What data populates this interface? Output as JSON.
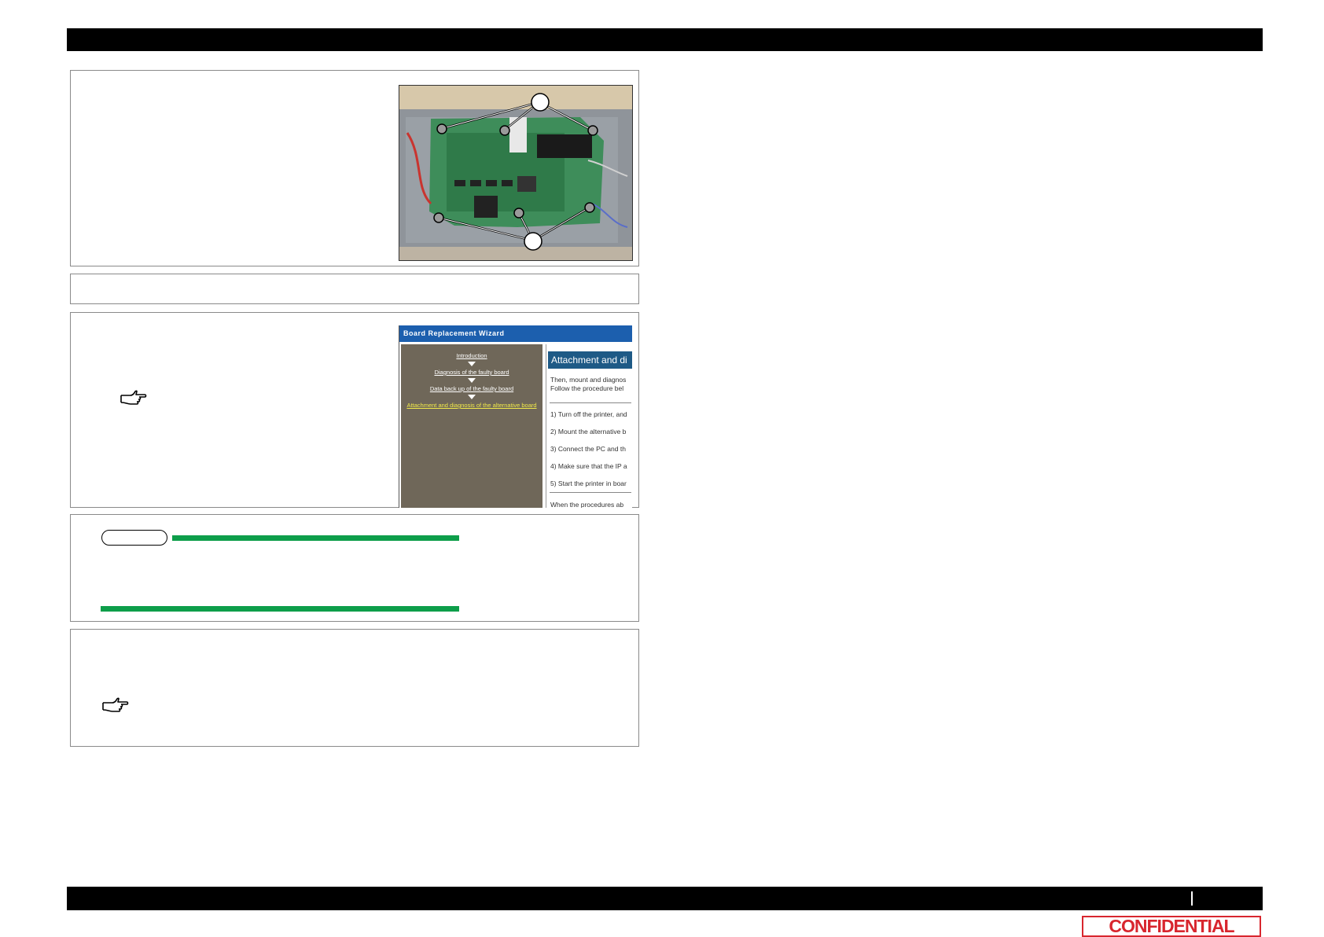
{
  "wizard": {
    "title": "Board Replacement Wizard",
    "steps": [
      {
        "label": "Introduction",
        "active": false
      },
      {
        "label": "Diagnosis of the faulty board",
        "active": false
      },
      {
        "label": "Data back up of the faulty board",
        "active": false
      },
      {
        "label": "Attachment and diagnosis of the alternative board",
        "active": true
      }
    ],
    "heading": "Attachment and di",
    "intro_lines": [
      "Then, mount and diagnos",
      "Follow the procedure bel"
    ],
    "steps_text": [
      "1) Turn off the printer, and",
      "2) Mount the alternative b",
      "3) Connect the PC and th",
      "4) Make sure that the IP a",
      "5) Start the printer in boar"
    ],
    "footer_line": "When the procedures ab"
  },
  "confidential_label": "CONFIDENTIAL",
  "colors": {
    "bar": "#000000",
    "note_green": "#0d9e4a",
    "confidential_red": "#d8262e",
    "wizard_blue": "#1c5fae"
  },
  "icons": {
    "reference": "pointing-hand-icon"
  }
}
